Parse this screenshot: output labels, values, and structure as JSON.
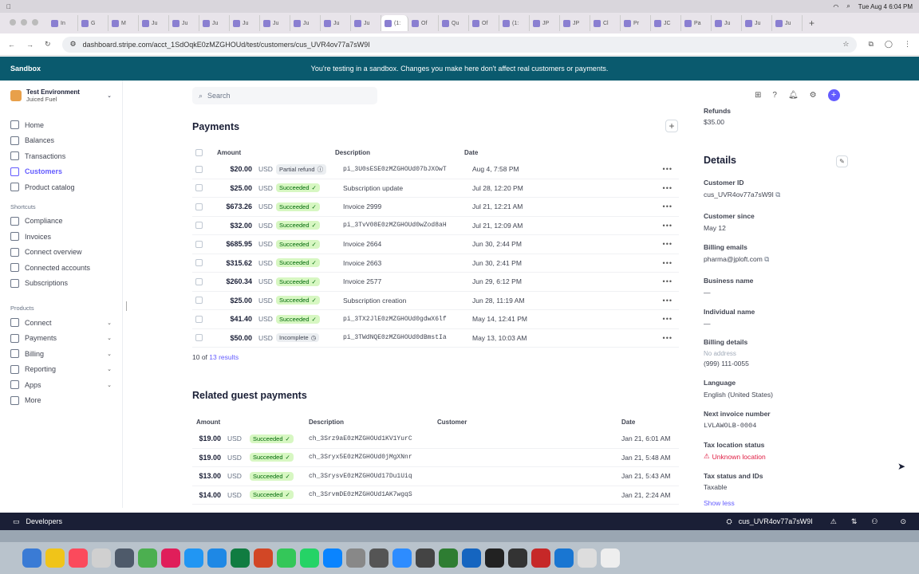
{
  "menubar": {
    "datetime": "Tue Aug 4  6:04 PM"
  },
  "tabs": [
    "In",
    "G",
    "M",
    "Ju",
    "Ju",
    "Ju",
    "Ju",
    "Ju",
    "Ju",
    "Ju",
    "Ju",
    "(1:",
    "Of",
    "Qu",
    "Of",
    "(1:",
    "JP",
    "JP",
    "Cl",
    "Pr",
    "JC",
    "Pa",
    "Ju",
    "Ju",
    "Ju"
  ],
  "address": {
    "url": "dashboard.stripe.com/acct_1SdOqkE0zMZGHOUd/test/customers/cus_UVR4ov77a7sW9I"
  },
  "banner": {
    "label": "Sandbox",
    "message": "You're testing in a sandbox. Changes you make here don't affect real customers or payments."
  },
  "sidebar": {
    "account_name": "Test Environment",
    "account_sub": "Juiced Fuel",
    "main": [
      "Home",
      "Balances",
      "Transactions",
      "Customers",
      "Product catalog"
    ],
    "shortcuts_title": "Shortcuts",
    "shortcuts": [
      "Compliance",
      "Invoices",
      "Connect overview",
      "Connected accounts",
      "Subscriptions"
    ],
    "products_title": "Products",
    "products": [
      "Connect",
      "Payments",
      "Billing",
      "Reporting",
      "Apps",
      "More"
    ]
  },
  "search": {
    "placeholder": "Search"
  },
  "payments": {
    "title": "Payments",
    "headers": {
      "amount": "Amount",
      "description": "Description",
      "date": "Date"
    },
    "rows": [
      {
        "amount": "$20.00",
        "cur": "USD",
        "status": "Partial refund",
        "desc": "pi_3U0sESE0zMZGHOUd07bJXOwT",
        "date": "Aug 4, 7:58 PM"
      },
      {
        "amount": "$25.00",
        "cur": "USD",
        "status": "Succeeded",
        "desc": "Subscription update",
        "date": "Jul 28, 12:20 PM"
      },
      {
        "amount": "$673.26",
        "cur": "USD",
        "status": "Succeeded",
        "desc": "Invoice 2999",
        "date": "Jul 21, 12:21 AM"
      },
      {
        "amount": "$32.00",
        "cur": "USD",
        "status": "Succeeded",
        "desc": "pi_3TvV08E0zMZGHOUd0wZod8aH",
        "date": "Jul 21, 12:09 AM"
      },
      {
        "amount": "$685.95",
        "cur": "USD",
        "status": "Succeeded",
        "desc": "Invoice 2664",
        "date": "Jun 30, 2:44 PM"
      },
      {
        "amount": "$315.62",
        "cur": "USD",
        "status": "Succeeded",
        "desc": "Invoice 2663",
        "date": "Jun 30, 2:41 PM"
      },
      {
        "amount": "$260.34",
        "cur": "USD",
        "status": "Succeeded",
        "desc": "Invoice 2577",
        "date": "Jun 29, 6:12 PM"
      },
      {
        "amount": "$25.00",
        "cur": "USD",
        "status": "Succeeded",
        "desc": "Subscription creation",
        "date": "Jun 28, 11:19 AM"
      },
      {
        "amount": "$41.40",
        "cur": "USD",
        "status": "Succeeded",
        "desc": "pi_3TX2JlE0zMZGHOUd0gdwX6lf",
        "date": "May 14, 12:41 PM"
      },
      {
        "amount": "$50.00",
        "cur": "USD",
        "status": "Incomplete",
        "desc": "pi_3TWdNQE0zMZGHOUd0dBmstIa",
        "date": "May 13, 10:03 AM"
      }
    ],
    "count_prefix": "10 of ",
    "count_link": "13 results"
  },
  "guest": {
    "title": "Related guest payments",
    "headers": {
      "amount": "Amount",
      "description": "Description",
      "customer": "Customer",
      "date": "Date"
    },
    "rows": [
      {
        "amount": "$19.00",
        "cur": "USD",
        "status": "Succeeded",
        "desc": "ch_3Srz9aE0zMZGHOUd1KV1YurC",
        "date": "Jan 21, 6:01 AM"
      },
      {
        "amount": "$19.00",
        "cur": "USD",
        "status": "Succeeded",
        "desc": "ch_3Sryx5E0zMZGHOUd0jMgXNnr",
        "date": "Jan 21, 5:48 AM"
      },
      {
        "amount": "$13.00",
        "cur": "USD",
        "status": "Succeeded",
        "desc": "ch_3SrysvE0zMZGHOUd17Du1Uiq",
        "date": "Jan 21, 5:43 AM"
      },
      {
        "amount": "$14.00",
        "cur": "USD",
        "status": "Succeeded",
        "desc": "ch_3SrvmDE0zMZGHOUd1AK7wgqS",
        "date": "Jan 21, 2:24 AM"
      }
    ]
  },
  "details": {
    "refunds_label": "Refunds",
    "refunds_value": "$35.00",
    "title": "Details",
    "fields": [
      {
        "label": "Customer ID",
        "value": "cus_UVR4ov77a7sW9I"
      },
      {
        "label": "Customer since",
        "value": "May 12"
      },
      {
        "label": "Billing emails",
        "value": "pharma@jploft.com"
      },
      {
        "label": "Business name",
        "value": "—"
      },
      {
        "label": "Individual name",
        "value": "—"
      }
    ],
    "billing_details_label": "Billing details",
    "no_address": "No address",
    "phone": "(999) 111-0055",
    "language_label": "Language",
    "language": "English (United States)",
    "next_invoice_label": "Next invoice number",
    "next_invoice": "LVLAWOLB-0004",
    "tax_location_label": "Tax location status",
    "tax_location": "Unknown location",
    "tax_status_label": "Tax status and IDs",
    "tax_status": "Taxable",
    "show_less": "Show less"
  },
  "devbar": {
    "label": "Developers",
    "customer": "cus_UVR4ov77a7sW9I"
  },
  "colors": {
    "accent": "#635bff",
    "banner": "#0a5a6e",
    "success_bg": "#d7f7c2",
    "success_fg": "#006908",
    "danger": "#df1b41"
  }
}
